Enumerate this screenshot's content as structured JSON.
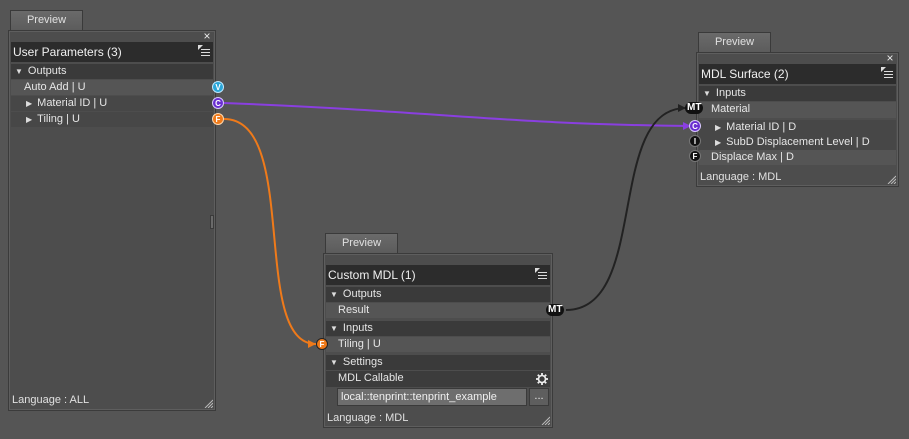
{
  "colors": {
    "wire_color": "#8a3fe0",
    "wire_float": "#ef7a1a",
    "wire_material": "#222222",
    "port_color": "#6a2fd0",
    "port_float": "#ef7a1a",
    "port_variant": "#2aa6d8",
    "port_int": "#111111"
  },
  "user_params": {
    "preview_label": "Preview",
    "title": "User Parameters (3)",
    "outputs_label": "Outputs",
    "items": [
      {
        "label": "Auto Add  | U",
        "port": "V"
      },
      {
        "label": "Material ID  | U",
        "port": "C"
      },
      {
        "label": "Tiling  | U",
        "port": "F"
      }
    ],
    "language": "Language : ALL"
  },
  "custom_mdl": {
    "preview_label": "Preview",
    "title": "Custom MDL (1)",
    "outputs_label": "Outputs",
    "result_label": "Result",
    "result_port": "MT",
    "inputs_label": "Inputs",
    "tiling_label": "Tiling  | U",
    "tiling_port": "F",
    "settings_label": "Settings",
    "callable_label": "MDL Callable",
    "callable_value": "local::tenprint::tenprint_example",
    "browse_label": "...",
    "language": "Language : MDL"
  },
  "mdl_surface": {
    "preview_label": "Preview",
    "title": "MDL Surface (2)",
    "inputs_label": "Inputs",
    "material_label": "Material",
    "material_port": "MT",
    "items": [
      {
        "label": "Material ID  | D",
        "port": "C"
      },
      {
        "label": "SubD Displacement Level  | D",
        "port": "I"
      },
      {
        "label": "Displace Max  | D",
        "port": "F"
      }
    ],
    "language": "Language : MDL"
  }
}
